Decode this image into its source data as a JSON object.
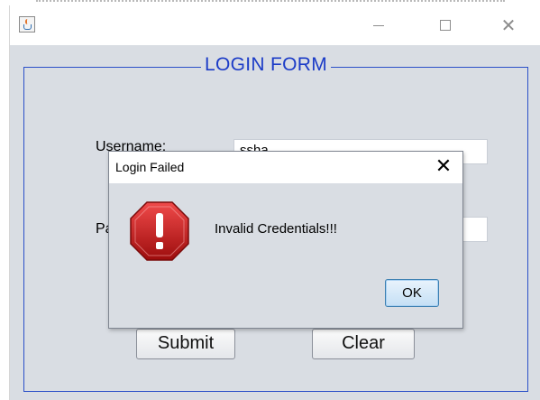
{
  "window": {
    "title": "",
    "minimize_icon": "minimize-icon",
    "maximize_icon": "maximize-icon",
    "close_icon": "close-icon"
  },
  "form": {
    "legend": "LOGIN FORM",
    "username_label": "Username:",
    "username_value": "ssha",
    "password_label": "Password:",
    "password_value": "",
    "submit_label": "Submit",
    "clear_label": "Clear",
    "border_color": "#2b50c8",
    "legend_color": "#1c3cc7"
  },
  "dialog": {
    "title": "Login Failed",
    "close_glyph": "✕",
    "message": "Invalid Credentials!!!",
    "ok_label": "OK",
    "icon": "error-icon",
    "icon_color": "#c81919"
  }
}
